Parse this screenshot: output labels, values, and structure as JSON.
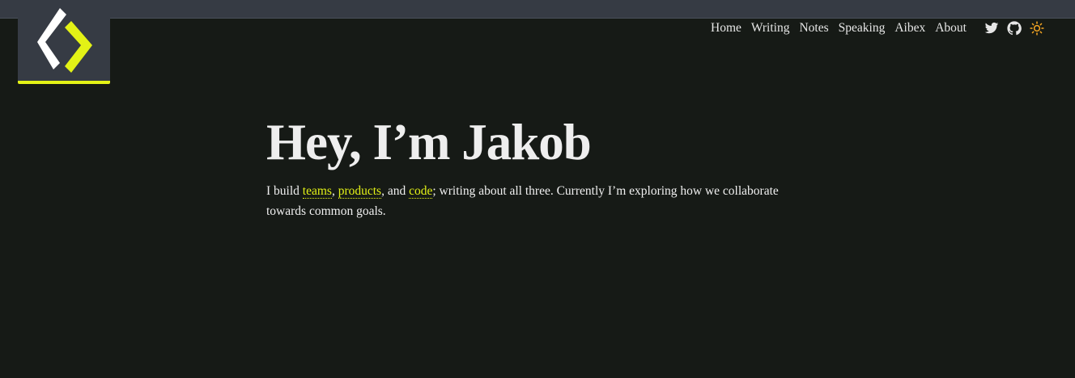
{
  "site": {
    "logo_icon": "code-brackets-logo",
    "accent_color": "#e3f216",
    "background_color": "#161a16",
    "header_color": "#363b44"
  },
  "nav": {
    "items": [
      {
        "label": "Home"
      },
      {
        "label": "Writing"
      },
      {
        "label": "Notes"
      },
      {
        "label": "Speaking"
      },
      {
        "label": "Aibex"
      },
      {
        "label": "About"
      }
    ],
    "icons": [
      "twitter-icon",
      "github-icon",
      "sun-icon"
    ]
  },
  "hero": {
    "title": "Hey, I’m Jakob",
    "intro_prefix": "I build ",
    "link_teams": "teams",
    "sep1": ", ",
    "link_products": "products",
    "sep2": ", and ",
    "link_code": "code",
    "intro_suffix": "; writing about all three. Currently I’m exploring how we collaborate towards common goals."
  }
}
